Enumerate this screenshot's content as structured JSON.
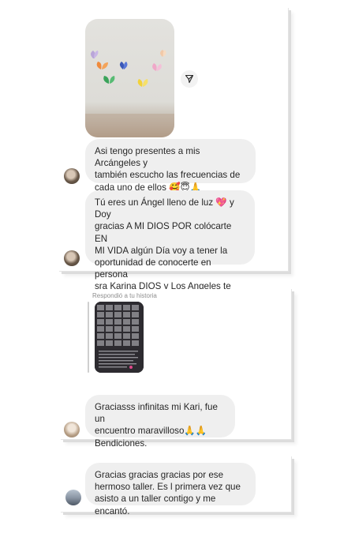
{
  "conversation": {
    "messages": [
      {
        "type": "photo",
        "description_icon": "share-icon"
      },
      {
        "type": "text",
        "text": "Asi tengo presentes a mis Arcángeles y\ntambién escucho las frecuencias de\ncada uno de ellos 🥰😇🙏"
      },
      {
        "type": "text",
        "text": "Tú eres un Ángel lleno de luz 💖 y Doy\ngracias A  MI DIOS POR colócarte EN\nMI VIDA  algún Día voy a tener la\noportunidad de conocerte en persona\nsra Karina DIOS y Los Angeles te sigan\nBendiciendo 🙏🏻🙏🏻"
      }
    ],
    "story_reply": {
      "label": "Respondió a tu historia",
      "message": "Graciasss infinitas mi Kari, fue un\nencuentro maravilloso🙏🙏\nBendiciones."
    },
    "last_message": {
      "text": "Gracias gracias gracias por ese\nhermoso taller. Es l primera vez que\nasisto a un taller contigo y me encantó."
    }
  },
  "colors": {
    "bubble": "#efefef",
    "text": "#262626",
    "meta": "#8e8e8e"
  }
}
